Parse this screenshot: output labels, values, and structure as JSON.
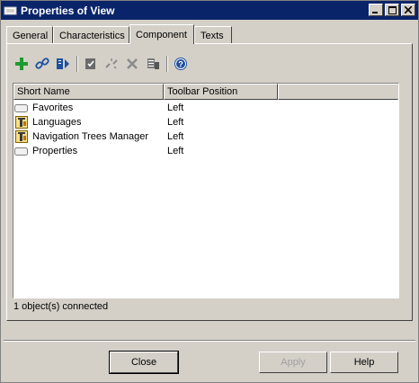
{
  "window": {
    "title": "Properties of View"
  },
  "tabs": [
    {
      "label": "General"
    },
    {
      "label": "Characteristics"
    },
    {
      "label": "Component"
    },
    {
      "label": "Texts"
    }
  ],
  "toolbar": {
    "icons": [
      "add-icon",
      "link-icon",
      "move-icon",
      "check-icon",
      "unlink-icon",
      "delete-icon",
      "list-icon",
      "help-icon"
    ]
  },
  "list": {
    "columns": [
      "Short Name",
      "Toolbar Position"
    ],
    "rows": [
      {
        "name": "Favorites",
        "position": "Left",
        "icon": "blank-icon"
      },
      {
        "name": "Languages",
        "position": "Left",
        "icon": "component-icon"
      },
      {
        "name": "Navigation Trees Manager",
        "position": "Left",
        "icon": "component-icon"
      },
      {
        "name": "Properties",
        "position": "Left",
        "icon": "blank-icon"
      }
    ]
  },
  "status": {
    "text": "1 object(s) connected"
  },
  "buttons": {
    "close": "Close",
    "apply": "Apply",
    "help": "Help"
  },
  "colors": {
    "titlebar": "#0a246a",
    "add_green": "#1f9a2e",
    "link_blue": "#1e50a0"
  }
}
